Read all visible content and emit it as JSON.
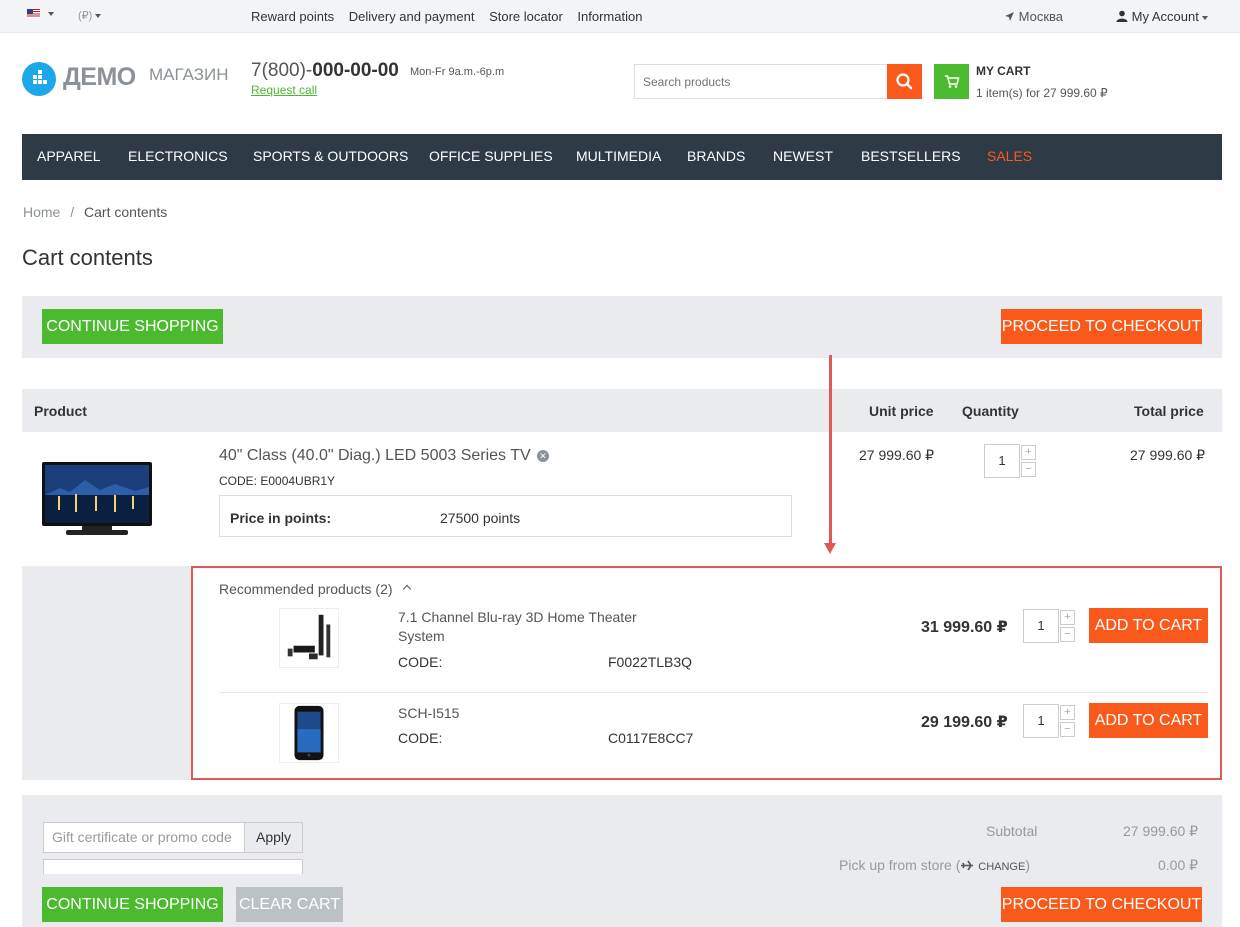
{
  "topbar": {
    "currency": "(₽)",
    "links": [
      "Reward points",
      "Delivery and payment",
      "Store locator",
      "Information"
    ],
    "city": "Москва",
    "account": "My Account"
  },
  "header": {
    "logo_main": "ДЕМО",
    "logo_sub": "МАГАЗИН",
    "phone_prefix": "7(800)-",
    "phone_main": "000-00-00",
    "hours": "Mon-Fr 9a.m.-6p.m",
    "request_call": "Request call",
    "search_placeholder": "Search products",
    "cart_title": "MY CART",
    "cart_summary": "1 item(s) for 27 999.60 ₽"
  },
  "menu": [
    "APPAREL",
    "ELECTRONICS",
    "SPORTS & OUTDOORS",
    "OFFICE SUPPLIES",
    "MULTIMEDIA",
    "BRANDS",
    "NEWEST",
    "BESTSELLERS",
    "SALES"
  ],
  "menu_highlight_color": "#f95a1c",
  "breadcrumb": {
    "home": "Home",
    "separator": "/",
    "current": "Cart contents"
  },
  "page_title": "Cart contents",
  "buttons": {
    "continue_shopping": "CONTINUE SHOPPING",
    "proceed_checkout": "PROCEED TO CHECKOUT",
    "clear_cart": "CLEAR CART",
    "add_to_cart": "ADD TO CART",
    "apply": "Apply"
  },
  "table": {
    "headers": {
      "product": "Product",
      "unit_price": "Unit price",
      "quantity": "Quantity",
      "total_price": "Total price"
    }
  },
  "cart_item": {
    "name": "40\" Class (40.0\" Diag.) LED 5003 Series TV",
    "code": "CODE: E0004UBR1Y",
    "points_label": "Price in points:",
    "points_value": "27500 points",
    "unit_price": "27 999.60 ₽",
    "quantity": "1",
    "total_price": "27 999.60 ₽"
  },
  "recommended": {
    "title": "Recommended products (2)",
    "code_label": "CODE:",
    "items": [
      {
        "name": "7.1 Channel Blu-ray 3D Home Theater System",
        "code": "F0022TLB3Q",
        "price": "31 999.60 ₽",
        "quantity": "1"
      },
      {
        "name": "SCH-I515",
        "code": "C0117E8CC7",
        "price": "29 199.60 ₽",
        "quantity": "1"
      }
    ]
  },
  "totals": {
    "promo_placeholder": "Gift certificate or promo code",
    "subtotal_label": "Subtotal",
    "subtotal_value": "27 999.60 ₽",
    "shipping_label": "Pick up from store (",
    "shipping_change": "CHANGE",
    "shipping_close": ")",
    "shipping_value": "0.00 ₽"
  },
  "colors": {
    "green": "#4cba2f",
    "orange": "#f95a1c",
    "dark_menu": "#2e3a45",
    "highlight_border": "#e05a55"
  }
}
